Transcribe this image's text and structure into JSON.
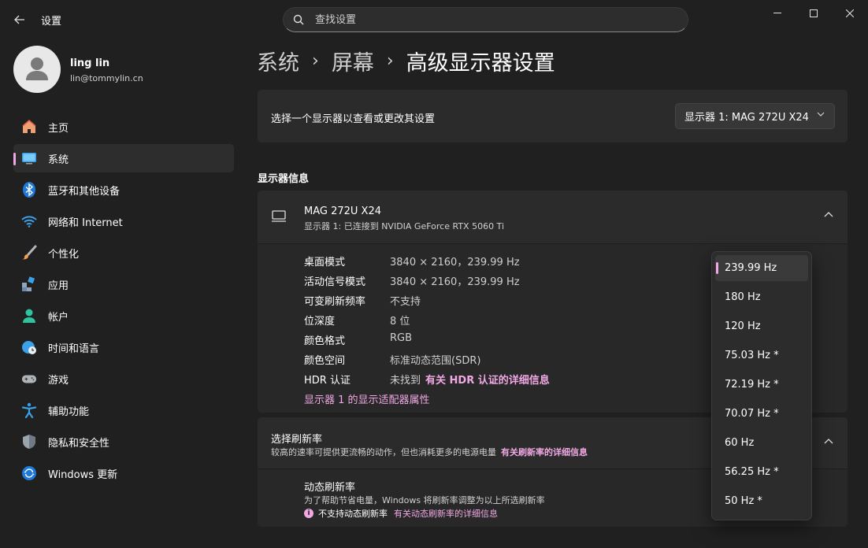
{
  "titlebar": {
    "app_title": "设置",
    "search_placeholder": "查找设置"
  },
  "user": {
    "name": "ling lin",
    "email": "lin@tommylin.cn"
  },
  "sidebar": {
    "items": [
      {
        "label": "主页",
        "icon": "home-icon"
      },
      {
        "label": "系统",
        "icon": "system-monitor-icon",
        "active": true
      },
      {
        "label": "蓝牙和其他设备",
        "icon": "bluetooth-icon"
      },
      {
        "label": "网络和 Internet",
        "icon": "wifi-icon"
      },
      {
        "label": "个性化",
        "icon": "brush-icon"
      },
      {
        "label": "应用",
        "icon": "apps-icon"
      },
      {
        "label": "帐户",
        "icon": "account-icon"
      },
      {
        "label": "时间和语言",
        "icon": "globe-clock-icon"
      },
      {
        "label": "游戏",
        "icon": "gamepad-icon"
      },
      {
        "label": "辅助功能",
        "icon": "accessibility-icon"
      },
      {
        "label": "隐私和安全性",
        "icon": "shield-icon"
      },
      {
        "label": "Windows 更新",
        "icon": "update-icon"
      }
    ]
  },
  "breadcrumb": {
    "items": [
      "系统",
      "屏幕",
      "高级显示器设置"
    ]
  },
  "select_display": {
    "label": "选择一个显示器以查看或更改其设置",
    "selected": "显示器 1: MAG 272U X24"
  },
  "display_info": {
    "section_title": "显示器信息",
    "monitor_name": "MAG 272U X24",
    "monitor_sub": "显示器 1: 已连接到 NVIDIA GeForce RTX 5060 Ti",
    "rows": [
      {
        "key": "桌面模式",
        "value": "3840 × 2160，239.99 Hz"
      },
      {
        "key": "活动信号模式",
        "value": "3840 × 2160，239.99 Hz"
      },
      {
        "key": "可变刷新频率",
        "value": "不支持"
      },
      {
        "key": "位深度",
        "value": "8 位"
      },
      {
        "key": "颜色格式",
        "value": "RGB"
      },
      {
        "key": "颜色空间",
        "value": "标准动态范围(SDR)"
      }
    ],
    "hdr_key": "HDR 认证",
    "hdr_value": "未找到",
    "hdr_link": "有关 HDR 认证的详细信息",
    "adapter_link": "显示器 1 的显示适配器属性"
  },
  "refresh": {
    "title": "选择刷新率",
    "subtitle": "较高的速率可提供更流畅的动作，但也消耗更多的电源电量",
    "link": "有关刷新率的详细信息",
    "dynamic_title": "动态刷新率",
    "dynamic_sub": "为了帮助节省电量，Windows 将刷新率调整为以上所选刷新率",
    "dynamic_note": "不支持动态刷新率",
    "dynamic_link": "有关动态刷新率的详细信息"
  },
  "refresh_options": {
    "items": [
      "239.99 Hz",
      "180 Hz",
      "120 Hz",
      "75.03 Hz *",
      "72.19 Hz *",
      "70.07 Hz *",
      "60 Hz",
      "56.25 Hz *",
      "50 Hz *"
    ],
    "selected_index": 0
  },
  "colors": {
    "accent": "#f0a8e4",
    "background": "#202020",
    "card": "#2b2b2b"
  }
}
